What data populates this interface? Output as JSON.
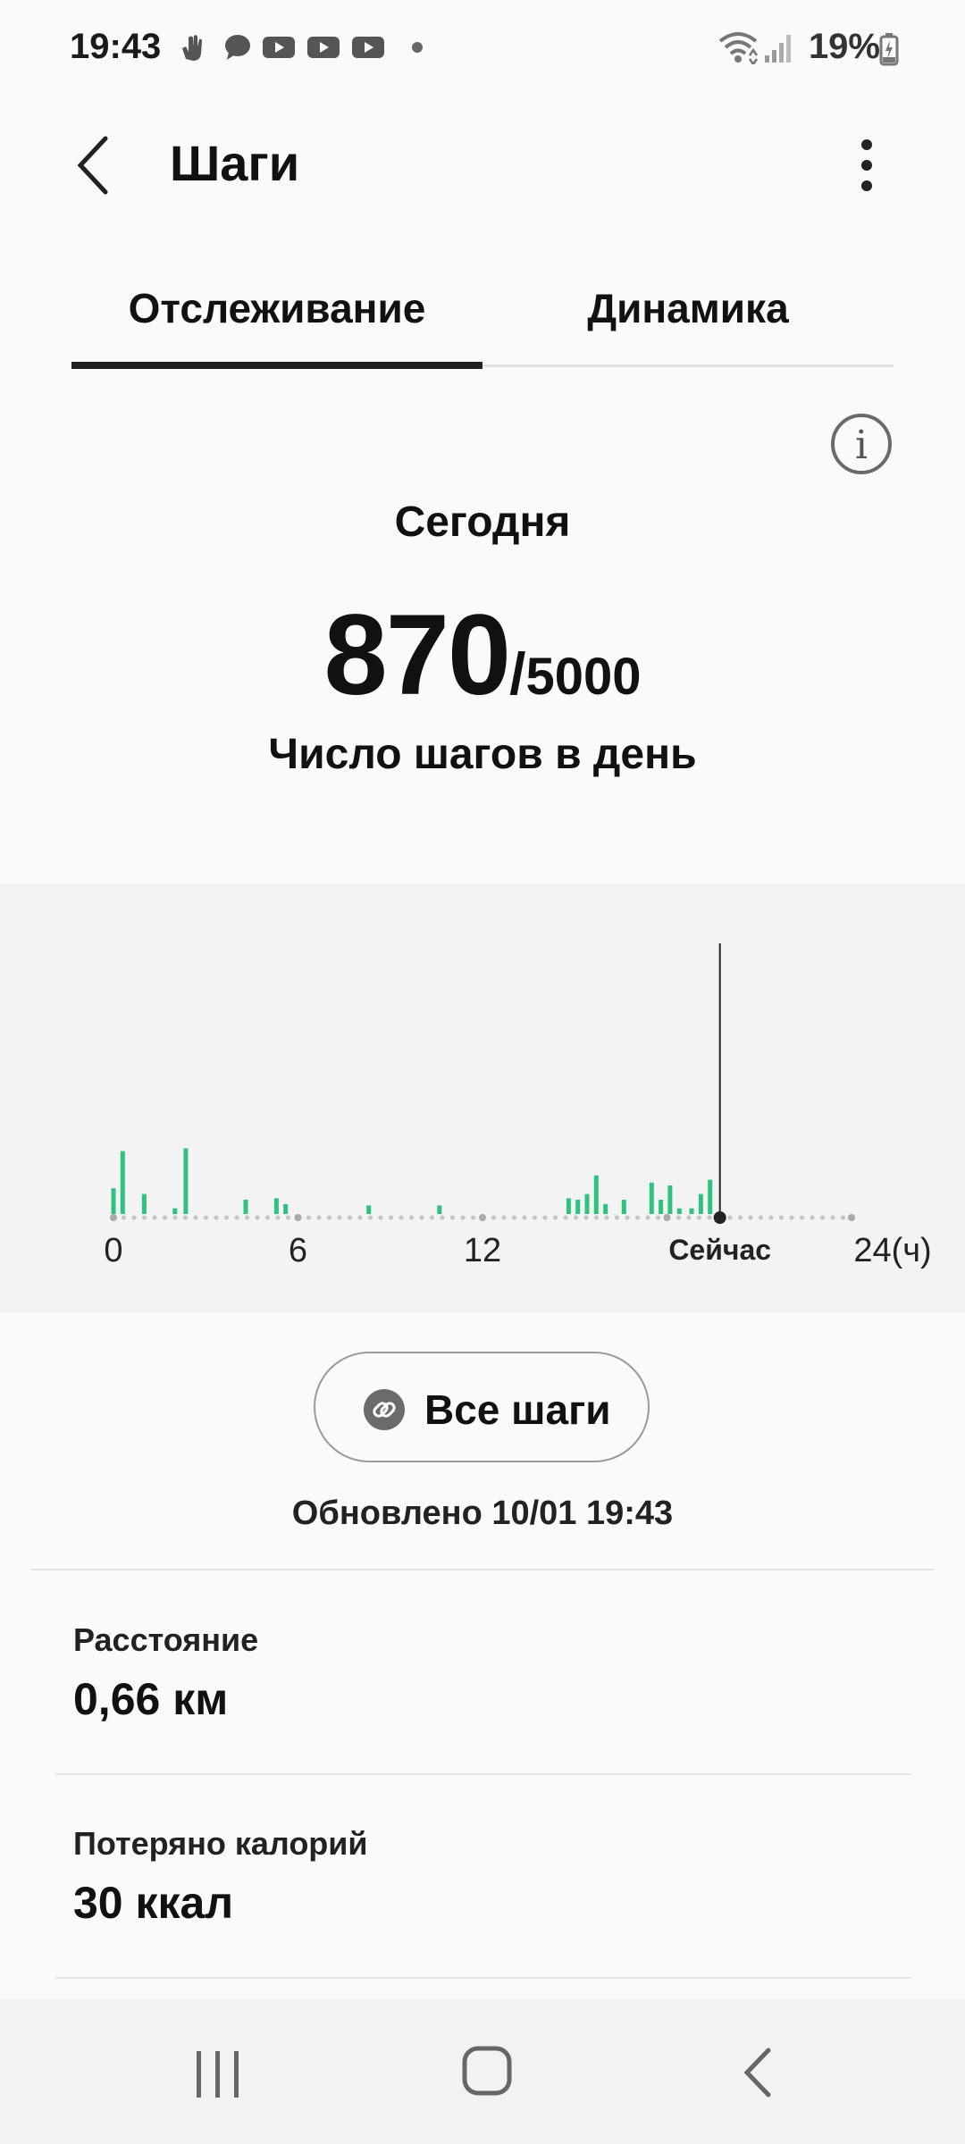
{
  "status_bar": {
    "time": "19:43",
    "battery": "19%",
    "notification_icons": [
      "hand-stop-icon",
      "chat-bubble-icon",
      "youtube-icon",
      "youtube-icon",
      "youtube-icon",
      "dot-icon"
    ],
    "system_icons": [
      "wifi-icon",
      "signal-icon",
      "battery-charging-icon"
    ]
  },
  "app_bar": {
    "title": "Шаги",
    "back_icon": "chevron-left-icon",
    "more_icon": "more-vert-icon"
  },
  "tabs": [
    {
      "label": "Отслеживание",
      "active": true
    },
    {
      "label": "Динамика",
      "active": false
    }
  ],
  "summary": {
    "period": "Сегодня",
    "steps": "870",
    "separator": "/",
    "goal": "5000",
    "label": "Число шагов в день"
  },
  "chart_data": {
    "type": "bar",
    "x_unit": "hours",
    "x_range": [
      0,
      24
    ],
    "tick_labels": [
      "0",
      "6",
      "12",
      "Сейчас",
      "24(ч)"
    ],
    "now_hour": 19.72,
    "bar_color": "#2ec27e",
    "bars": [
      {
        "x": 0.0,
        "value": 18
      },
      {
        "x": 0.3,
        "value": 44
      },
      {
        "x": 1.0,
        "value": 14
      },
      {
        "x": 2.0,
        "value": 4
      },
      {
        "x": 2.35,
        "value": 46
      },
      {
        "x": 4.3,
        "value": 10
      },
      {
        "x": 5.3,
        "value": 11
      },
      {
        "x": 5.6,
        "value": 7
      },
      {
        "x": 8.3,
        "value": 6
      },
      {
        "x": 10.6,
        "value": 6
      },
      {
        "x": 14.8,
        "value": 11
      },
      {
        "x": 15.1,
        "value": 10
      },
      {
        "x": 15.4,
        "value": 14
      },
      {
        "x": 15.7,
        "value": 27
      },
      {
        "x": 16.0,
        "value": 7
      },
      {
        "x": 16.6,
        "value": 10
      },
      {
        "x": 17.5,
        "value": 22
      },
      {
        "x": 17.8,
        "value": 10
      },
      {
        "x": 18.1,
        "value": 20
      },
      {
        "x": 18.4,
        "value": 4
      },
      {
        "x": 18.8,
        "value": 4
      },
      {
        "x": 19.1,
        "value": 14
      },
      {
        "x": 19.4,
        "value": 24
      }
    ]
  },
  "all_steps_button": {
    "label": "Все шаги",
    "icon": "link-icon"
  },
  "updated": "Обновлено 10/01 19:43",
  "stats": [
    {
      "title": "Расстояние",
      "value": "0,66 км"
    },
    {
      "title": "Потеряно калорий",
      "value": "30 ккал"
    }
  ],
  "nav_bar": {
    "icons": [
      "recent-apps-icon",
      "home-icon",
      "back-icon"
    ]
  }
}
